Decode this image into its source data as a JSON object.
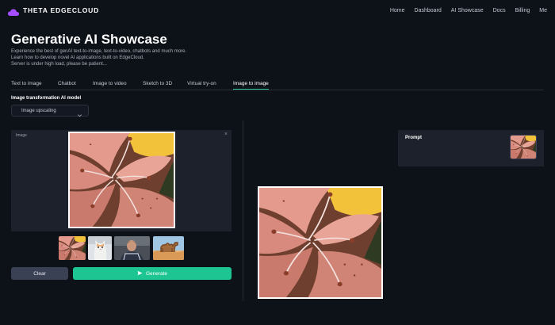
{
  "brand": {
    "name": "THETA EDGECLOUD",
    "color": "#a64dff"
  },
  "nav": {
    "links": [
      "Home",
      "Dashboard",
      "AI Showcase",
      "Docs",
      "Billing",
      "Me"
    ]
  },
  "header": {
    "title": "Generative AI Showcase",
    "lines": [
      "Experience the best of genAI text-to-image, text-to-video, chatbots and much more.",
      "Learn how to develop novel AI applications built on EdgeCloud.",
      "Server is under high load, please be patient..."
    ]
  },
  "tabs": [
    "Text to image",
    "Chatbot",
    "Image to video",
    "Sketch to 3D",
    "Virtual try-on",
    "Image to image"
  ],
  "active_tab": "Image to image",
  "model": {
    "label": "Image transformation AI model",
    "selected": "Image upscaling"
  },
  "image_panel": {
    "label": "Image",
    "close": "×"
  },
  "thumbnails": [
    {
      "name": "lily-flower"
    },
    {
      "name": "kitten"
    },
    {
      "name": "person-portrait"
    },
    {
      "name": "camel-desert"
    }
  ],
  "buttons": {
    "clear": "Clear",
    "generate": "Generate"
  },
  "prompt": {
    "label": "Prompt"
  },
  "icons": {
    "logo": "theta-cloud-icon",
    "chevron": "chevron-down-icon",
    "close": "close-icon",
    "generate": "send-icon"
  },
  "colors": {
    "accent": "#1cc591",
    "background": "#0d1118",
    "panel": "#1c212b",
    "clear_button": "#3a4154"
  }
}
